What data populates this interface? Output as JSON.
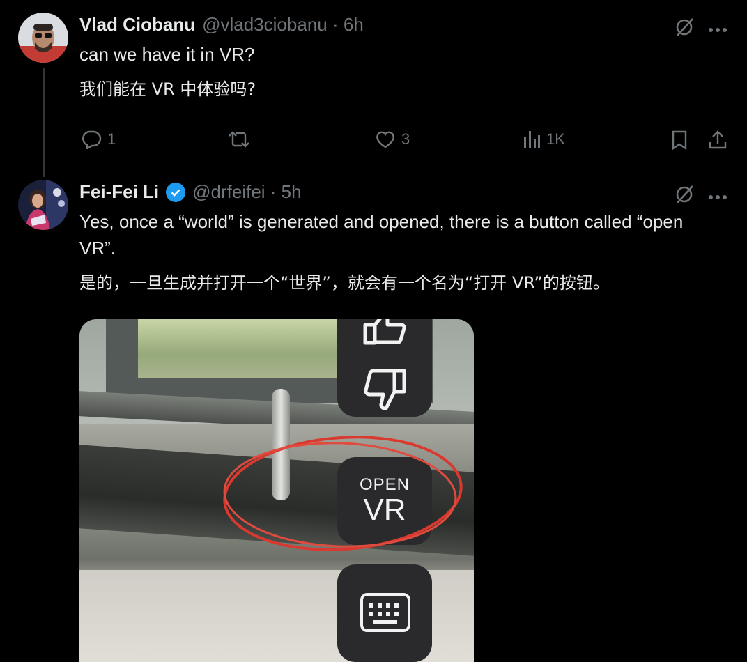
{
  "tweet1": {
    "name": "Vlad Ciobanu",
    "handle": "@vlad3ciobanu · 6h",
    "text_en": "can we have it in VR?",
    "text_cn": "我们能在 VR 中体验吗?",
    "replies": "1",
    "likes": "3",
    "views": "1K"
  },
  "tweet2": {
    "name": "Fei-Fei Li",
    "handle": "@drfeifei · 5h",
    "text_en_line1": "Yes, once a “world” is generated and opened, there is a button called “open",
    "text_en_line2": "VR”.",
    "text_cn": "是的，一旦生成并打开一个“世界”，就会有一个名为“打开 VR”的按钮。",
    "media": {
      "open_label": "OPEN",
      "vr_label": "VR"
    }
  }
}
